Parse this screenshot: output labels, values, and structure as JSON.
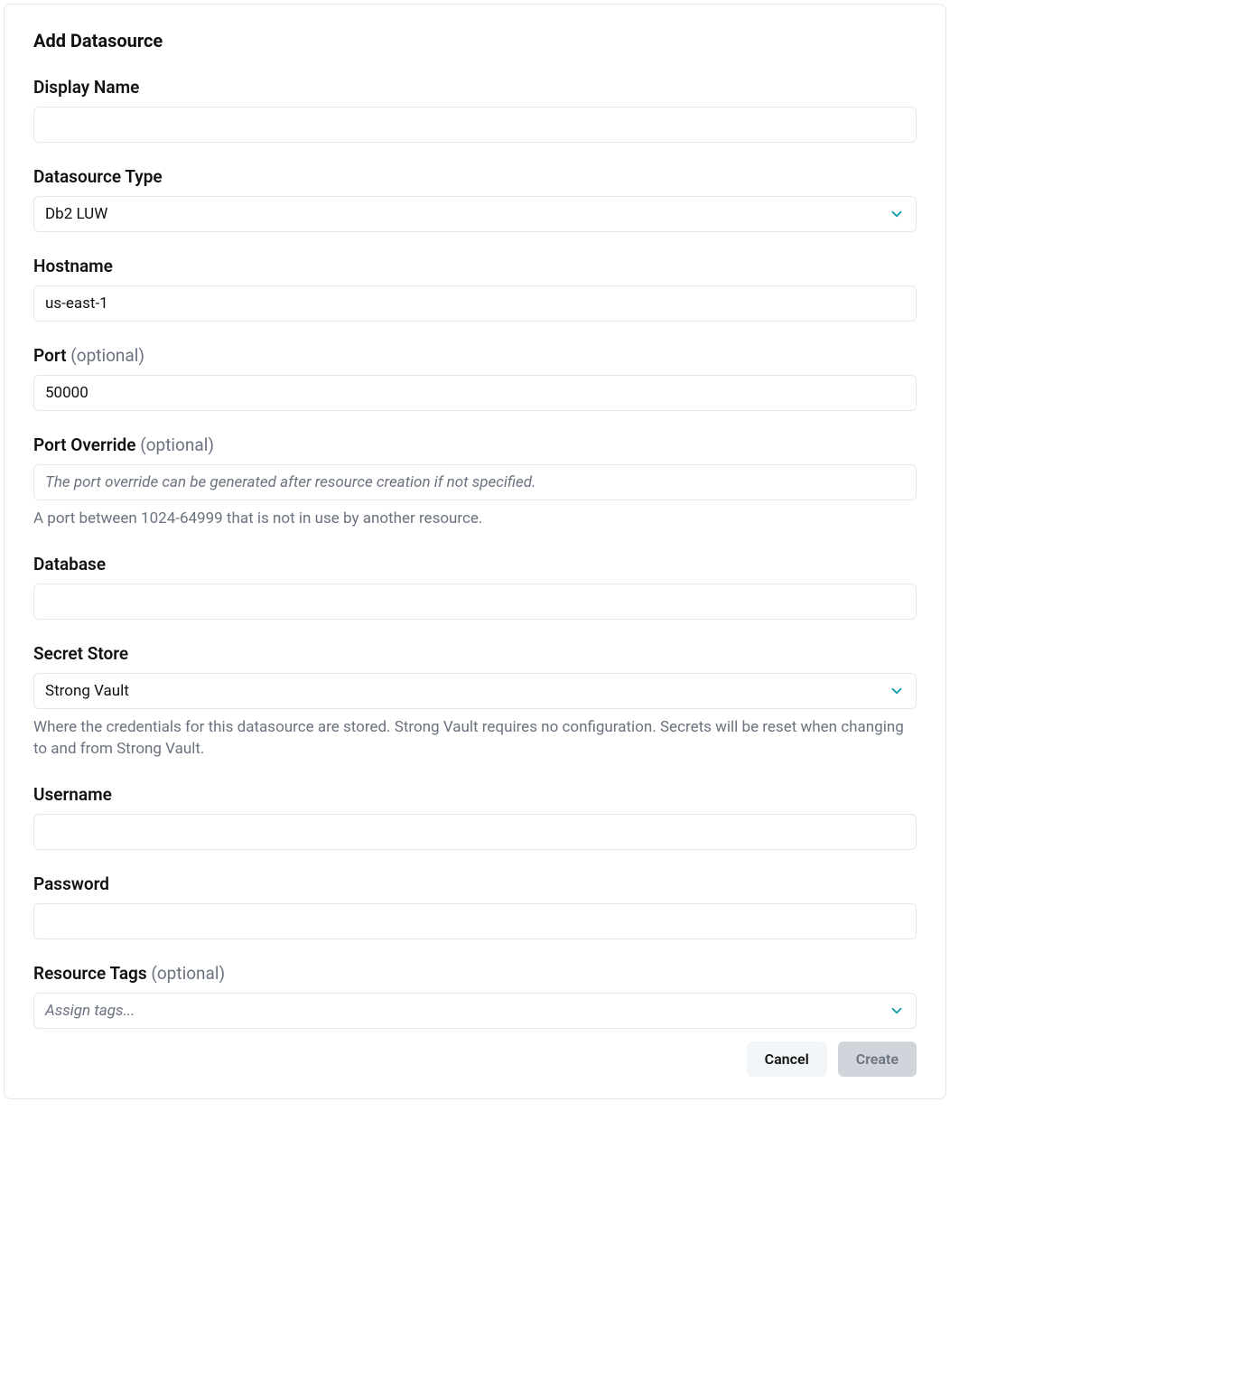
{
  "title": "Add Datasource",
  "fields": {
    "display_name": {
      "label": "Display Name",
      "value": ""
    },
    "datasource_type": {
      "label": "Datasource Type",
      "value": "Db2 LUW"
    },
    "hostname": {
      "label": "Hostname",
      "value": "us-east-1"
    },
    "port": {
      "label": "Port ",
      "optional": "(optional)",
      "value": "50000"
    },
    "port_override": {
      "label": "Port Override ",
      "optional": "(optional)",
      "placeholder": "The port override can be generated after resource creation if not specified.",
      "helper": "A port between 1024-64999 that is not in use by another resource."
    },
    "database": {
      "label": "Database",
      "value": ""
    },
    "secret_store": {
      "label": "Secret Store",
      "value": "Strong Vault",
      "helper": "Where the credentials for this datasource are stored. Strong Vault requires no configuration. Secrets will be reset when changing to and from Strong Vault."
    },
    "username": {
      "label": "Username",
      "value": ""
    },
    "password": {
      "label": "Password",
      "value": ""
    },
    "resource_tags": {
      "label": "Resource Tags ",
      "optional": "(optional)",
      "placeholder": "Assign tags..."
    }
  },
  "buttons": {
    "cancel": "Cancel",
    "create": "Create"
  }
}
